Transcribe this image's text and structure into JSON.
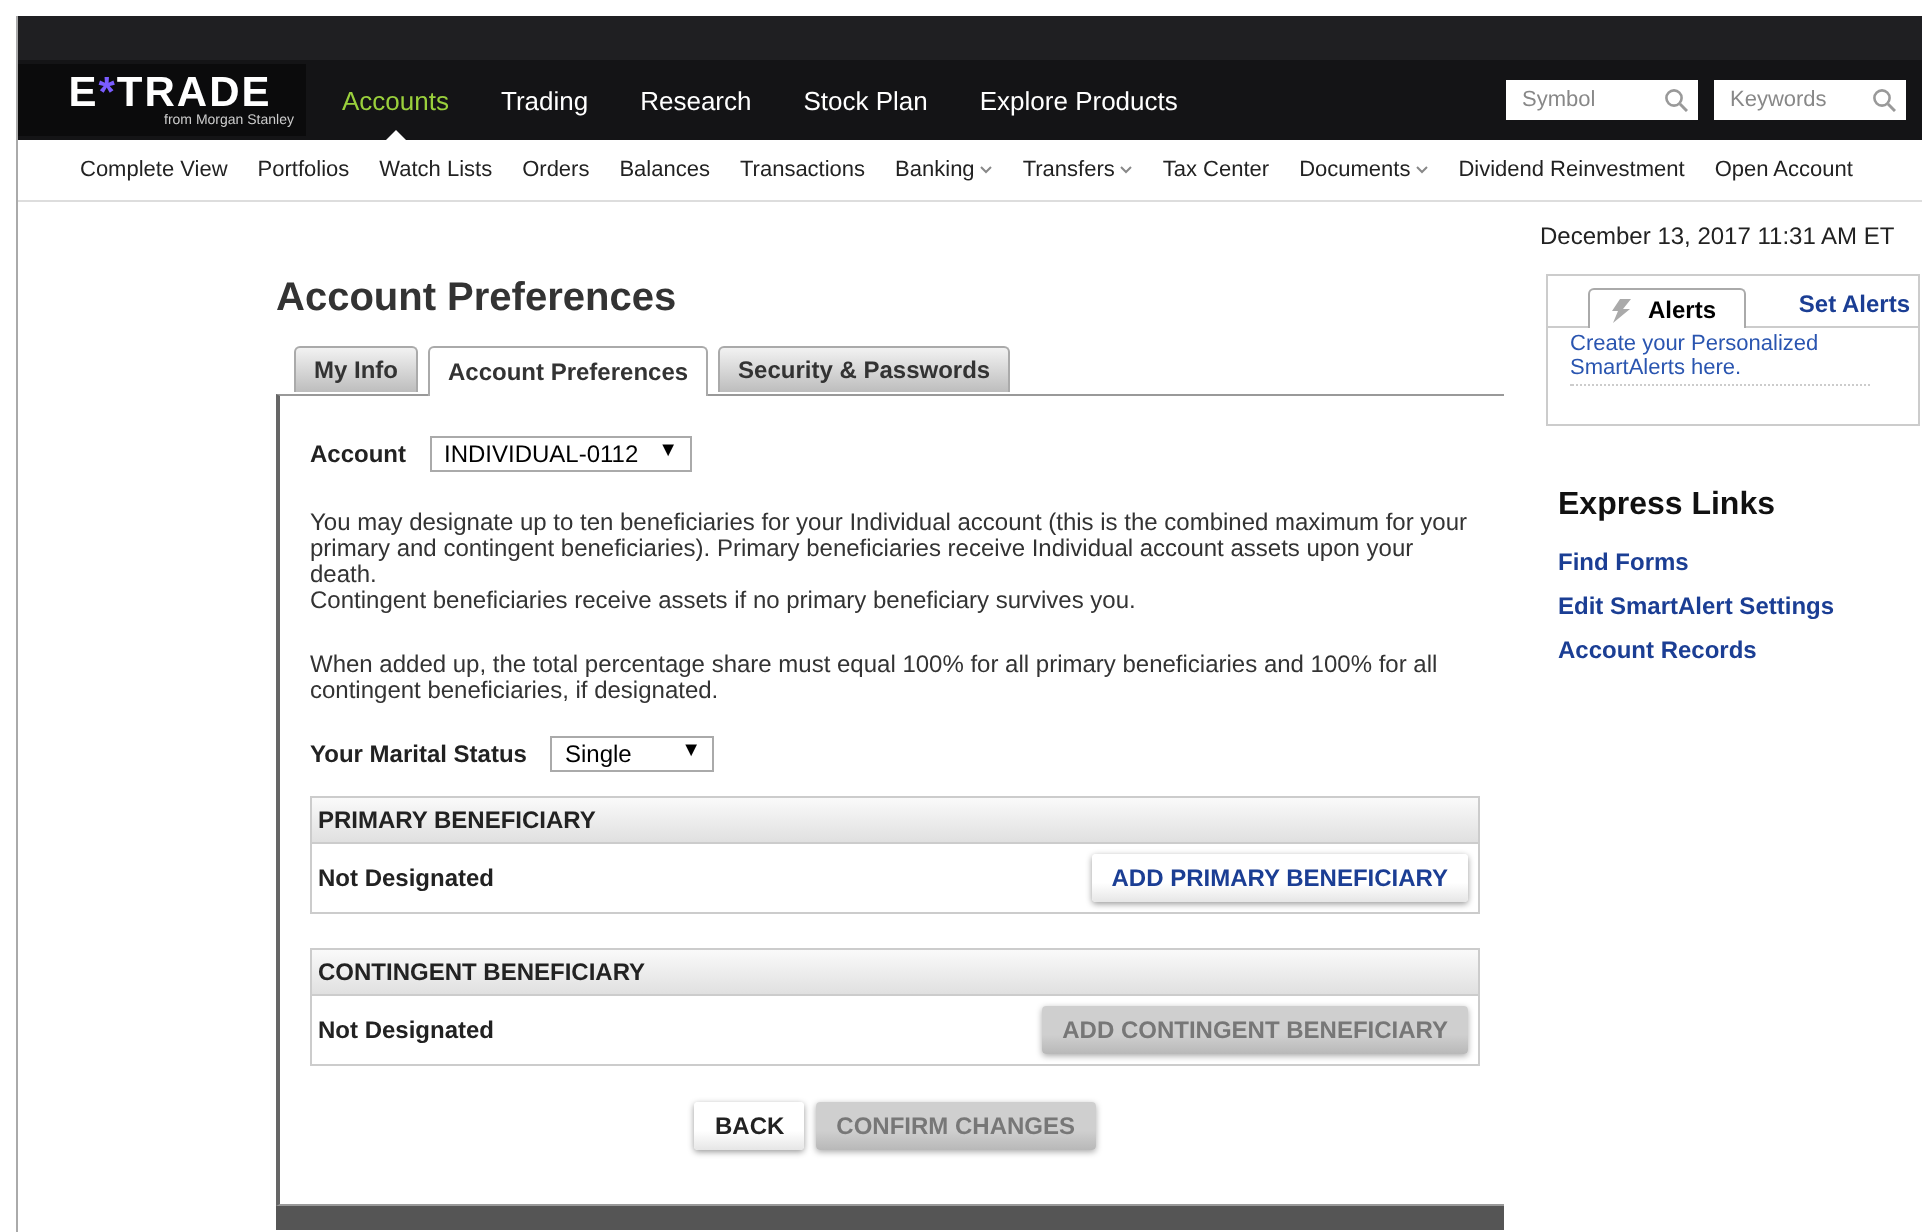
{
  "logo": {
    "brand": "E*TRADE",
    "tagline": "from Morgan Stanley"
  },
  "main_nav": [
    {
      "label": "Accounts",
      "selected": true
    },
    {
      "label": "Trading",
      "selected": false
    },
    {
      "label": "Research",
      "selected": false
    },
    {
      "label": "Stock Plan",
      "selected": false
    },
    {
      "label": "Explore Products",
      "selected": false
    }
  ],
  "search_fields": [
    {
      "placeholder": "Symbol"
    },
    {
      "placeholder": "Keywords"
    }
  ],
  "sub_nav": [
    {
      "label": "Complete View",
      "has_menu": false
    },
    {
      "label": "Portfolios",
      "has_menu": false
    },
    {
      "label": "Watch Lists",
      "has_menu": false
    },
    {
      "label": "Orders",
      "has_menu": false
    },
    {
      "label": "Balances",
      "has_menu": false
    },
    {
      "label": "Transactions",
      "has_menu": false
    },
    {
      "label": "Banking",
      "has_menu": true
    },
    {
      "label": "Transfers",
      "has_menu": true
    },
    {
      "label": "Tax Center",
      "has_menu": false
    },
    {
      "label": "Documents",
      "has_menu": true
    },
    {
      "label": "Dividend Reinvestment",
      "has_menu": false
    },
    {
      "label": "Open Account",
      "has_menu": false
    }
  ],
  "page_title": "Account Preferences",
  "tabs": [
    {
      "label": "My Info",
      "selected": false
    },
    {
      "label": "Account Preferences",
      "selected": true
    },
    {
      "label": "Security & Passwords",
      "selected": false
    }
  ],
  "account": {
    "label": "Account",
    "value": "INDIVIDUAL-0112",
    "arrow": "▼"
  },
  "paragraphs": [
    "You may designate up to ten beneficiaries for your Individual account (this is the combined maximum for your primary and contingent beneficiaries). Primary beneficiaries receive Individual account assets upon your death.\nContingent beneficiaries receive assets if no primary beneficiary survives you.",
    "When added up, the total percentage share must equal 100% for all primary beneficiaries and 100% for all contingent beneficiaries, if designated."
  ],
  "marital_status": {
    "label": "Your Marital Status",
    "value": "Single",
    "arrow": "▼"
  },
  "sections": [
    {
      "title": "PRIMARY BENEFICIARY",
      "status": "Not Designated",
      "button": {
        "label": "ADD PRIMARY BENEFICIARY",
        "disabled": false
      }
    },
    {
      "title": "CONTINGENT BENEFICIARY",
      "status": "Not Designated",
      "button": {
        "label": "ADD CONTINGENT BENEFICIARY",
        "disabled": true
      }
    }
  ],
  "actions": [
    {
      "label": "BACK",
      "disabled": false
    },
    {
      "label": "CONFIRM CHANGES",
      "disabled": true
    }
  ],
  "timestamp": "December 13, 2017 11:31 AM ET",
  "alerts": {
    "tab": "Alerts",
    "set_link": "Set Alerts",
    "message": "Create your Personalized SmartAlerts here."
  },
  "express_links": {
    "title": "Express Links",
    "links": [
      "Find Forms",
      "Edit SmartAlert Settings",
      "Account Records"
    ]
  }
}
